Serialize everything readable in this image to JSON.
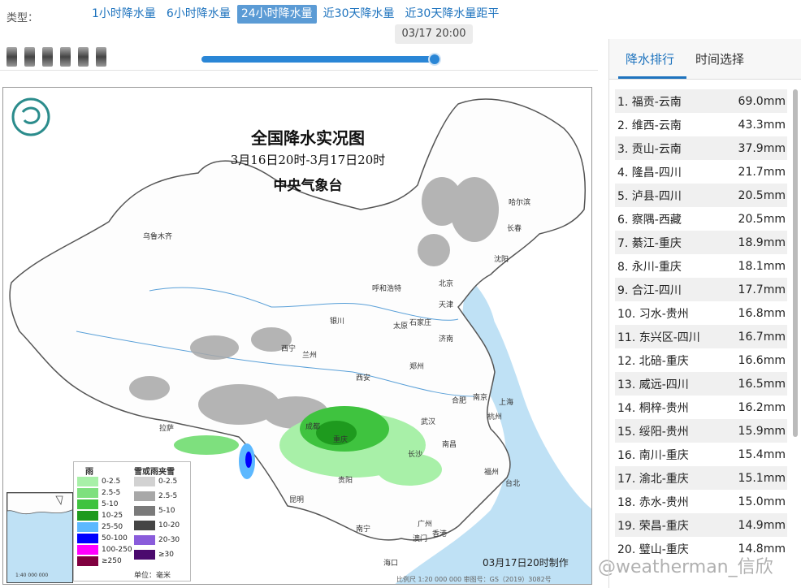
{
  "type_bar": {
    "label": "类型：",
    "tabs": [
      {
        "label": "1小时降水量",
        "active": false
      },
      {
        "label": "6小时降水量",
        "active": false
      },
      {
        "label": "24小时降水量",
        "active": true
      },
      {
        "label": "近30天降水量",
        "active": false
      },
      {
        "label": "近30天降水量距平",
        "active": false
      }
    ]
  },
  "timeline": {
    "current_time": "03/17 20:00",
    "progress": 1.0
  },
  "map": {
    "title": "全国降水实况图",
    "subtitle": "3月16日20时-3月17日20时",
    "org": "中央气象台",
    "made": "03月17日20时制作",
    "scale": "比例尺 1:20 000 000   审图号：GS（2019）3082号",
    "inset_label": "1:40 000 000",
    "cities": [
      {
        "name": "乌鲁木齐"
      },
      {
        "name": "哈尔滨"
      },
      {
        "name": "长春"
      },
      {
        "name": "沈阳"
      },
      {
        "name": "呼和浩特"
      },
      {
        "name": "北京"
      },
      {
        "name": "天津"
      },
      {
        "name": "银川"
      },
      {
        "name": "太原"
      },
      {
        "name": "石家庄"
      },
      {
        "name": "济南"
      },
      {
        "name": "西宁"
      },
      {
        "name": "兰州"
      },
      {
        "name": "郑州"
      },
      {
        "name": "西安"
      },
      {
        "name": "合肥"
      },
      {
        "name": "南京"
      },
      {
        "name": "上海"
      },
      {
        "name": "武汉"
      },
      {
        "name": "杭州"
      },
      {
        "name": "成都"
      },
      {
        "name": "重庆"
      },
      {
        "name": "拉萨"
      },
      {
        "name": "长沙"
      },
      {
        "name": "南昌"
      },
      {
        "name": "福州"
      },
      {
        "name": "贵阳"
      },
      {
        "name": "昆明"
      },
      {
        "name": "台北"
      },
      {
        "name": "南宁"
      },
      {
        "name": "广州"
      },
      {
        "name": "香港"
      },
      {
        "name": "澳门"
      },
      {
        "name": "海口"
      }
    ],
    "legend": {
      "rain_header": "雨",
      "snow_header": "雪或雨夹雪",
      "unit": "单位：毫米",
      "rain": [
        {
          "label": "0-2.5",
          "color": "#a8f0a8"
        },
        {
          "label": "2.5-5",
          "color": "#7ee07e"
        },
        {
          "label": "5-10",
          "color": "#3fc33f"
        },
        {
          "label": "10-25",
          "color": "#1e9a1e"
        },
        {
          "label": "25-50",
          "color": "#5cb8ff"
        },
        {
          "label": "50-100",
          "color": "#0000ff"
        },
        {
          "label": "100-250",
          "color": "#ff00ff"
        },
        {
          "label": "≥250",
          "color": "#800040"
        }
      ],
      "snow": [
        {
          "label": "0-2.5",
          "color": "#d2d2d2"
        },
        {
          "label": "2.5-5",
          "color": "#a8a8a8"
        },
        {
          "label": "5-10",
          "color": "#7a7a7a"
        },
        {
          "label": "10-20",
          "color": "#454545"
        },
        {
          "label": "20-30",
          "color": "#8a5cdb"
        },
        {
          "label": "≥30",
          "color": "#4b0a6e"
        }
      ]
    }
  },
  "watermark": "@weatherman_信欣",
  "right_panel": {
    "tabs": [
      "降水排行",
      "时间选择"
    ],
    "ranking": [
      {
        "rank": "1.",
        "place": "福贡-云南",
        "value": "69.0mm"
      },
      {
        "rank": "2.",
        "place": "维西-云南",
        "value": "43.3mm"
      },
      {
        "rank": "3.",
        "place": "贡山-云南",
        "value": "37.9mm"
      },
      {
        "rank": "4.",
        "place": "隆昌-四川",
        "value": "21.7mm"
      },
      {
        "rank": "5.",
        "place": "泸县-四川",
        "value": "20.5mm"
      },
      {
        "rank": "6.",
        "place": "察隅-西藏",
        "value": "20.5mm"
      },
      {
        "rank": "7.",
        "place": "綦江-重庆",
        "value": "18.9mm"
      },
      {
        "rank": "8.",
        "place": "永川-重庆",
        "value": "18.1mm"
      },
      {
        "rank": "9.",
        "place": "合江-四川",
        "value": "17.7mm"
      },
      {
        "rank": "10.",
        "place": "习水-贵州",
        "value": "16.8mm"
      },
      {
        "rank": "11.",
        "place": "东兴区-四川",
        "value": "16.7mm"
      },
      {
        "rank": "12.",
        "place": "北碚-重庆",
        "value": "16.6mm"
      },
      {
        "rank": "13.",
        "place": "威远-四川",
        "value": "16.5mm"
      },
      {
        "rank": "14.",
        "place": "桐梓-贵州",
        "value": "16.2mm"
      },
      {
        "rank": "15.",
        "place": "绥阳-贵州",
        "value": "15.9mm"
      },
      {
        "rank": "16.",
        "place": "南川-重庆",
        "value": "15.4mm"
      },
      {
        "rank": "17.",
        "place": "渝北-重庆",
        "value": "15.1mm"
      },
      {
        "rank": "18.",
        "place": "赤水-贵州",
        "value": "15.0mm"
      },
      {
        "rank": "19.",
        "place": "荣昌-重庆",
        "value": "14.9mm"
      },
      {
        "rank": "20.",
        "place": "璧山-重庆",
        "value": "14.8mm"
      }
    ]
  }
}
